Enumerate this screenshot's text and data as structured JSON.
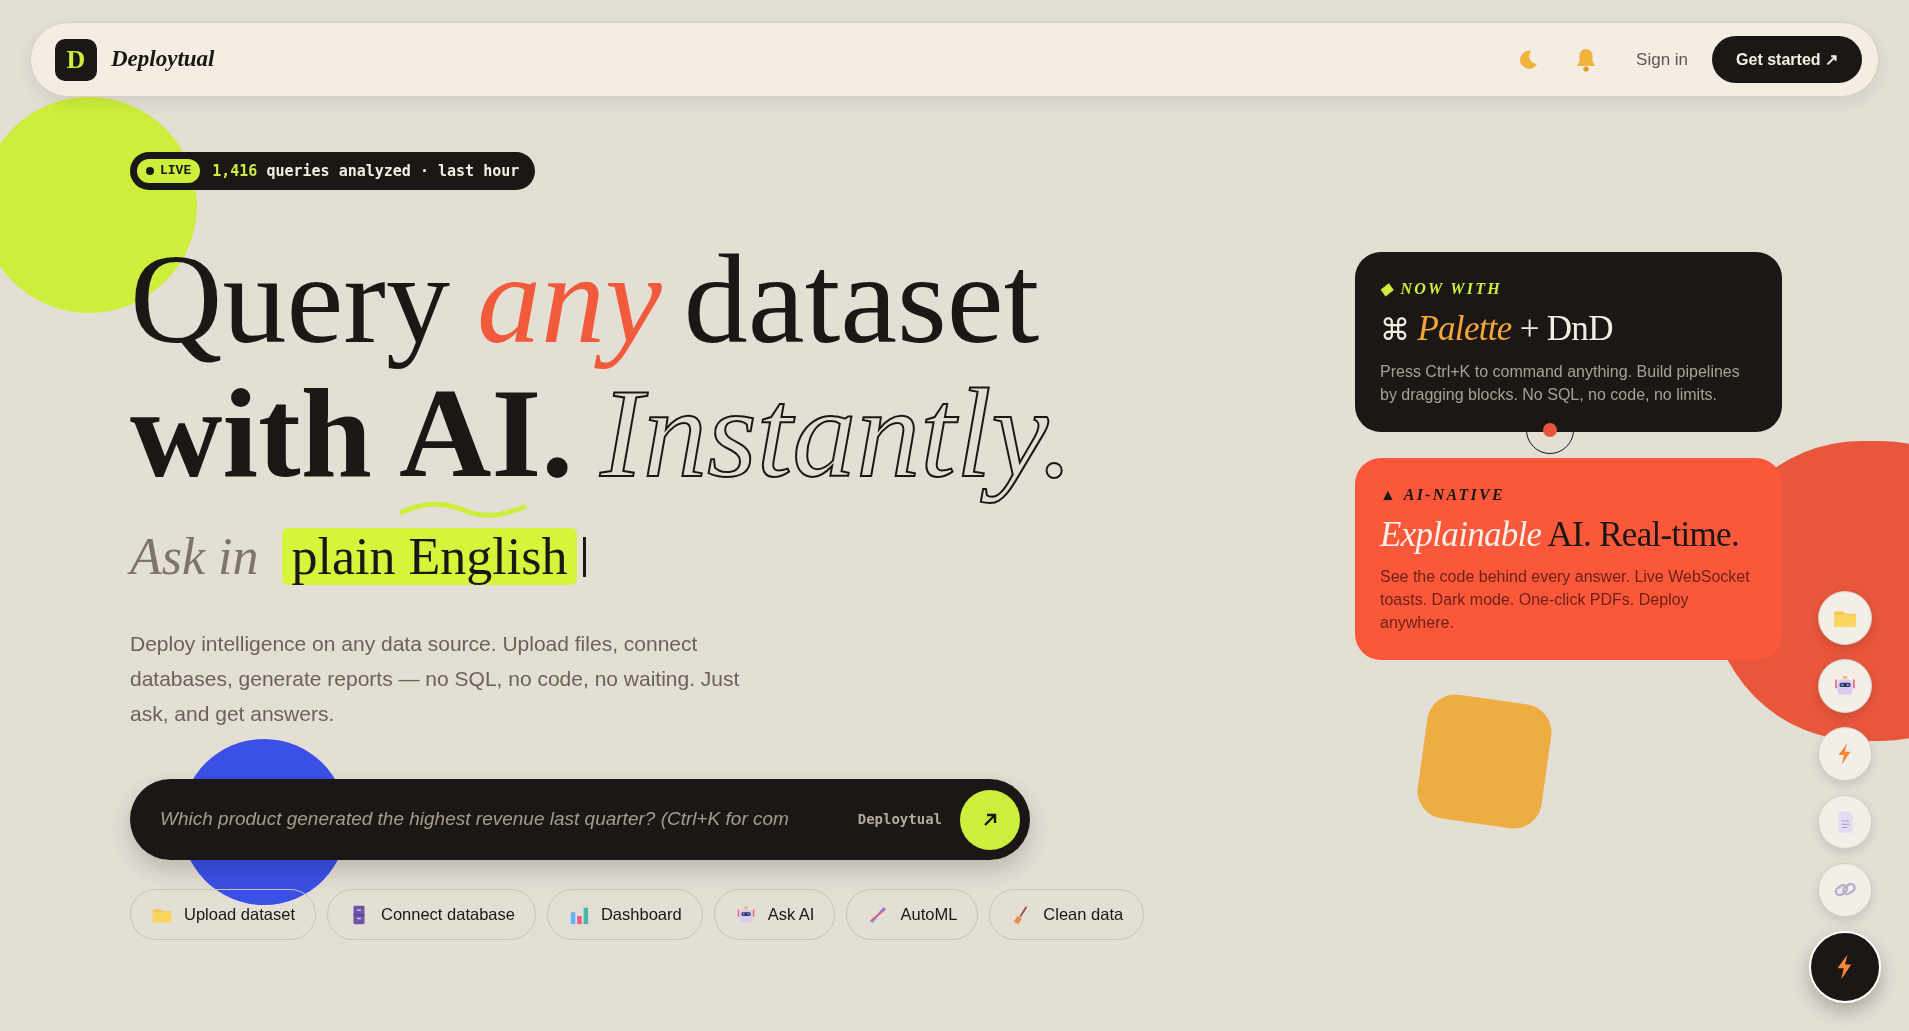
{
  "header": {
    "logo_letter": "D",
    "brand": "Deploytual",
    "sign_in": "Sign in",
    "cta": "Get started ↗"
  },
  "live": {
    "status": "LIVE",
    "count": "1,416",
    "text": "queries analyzed · last hour"
  },
  "headline": {
    "lines": [
      [
        {
          "text": "Query",
          "kind": "plain",
          "squiggle": false
        },
        {
          "text": "any",
          "kind": "accent",
          "squiggle": false
        },
        {
          "text": "dataset",
          "kind": "plain",
          "squiggle": false
        }
      ],
      [
        {
          "text": "with",
          "kind": "bold",
          "squiggle": false
        },
        {
          "text": "AI.",
          "kind": "bold",
          "squiggle": true
        },
        {
          "text": "Instantly.",
          "kind": "outline",
          "squiggle": false
        }
      ]
    ]
  },
  "subheading": {
    "lead": "Ask in",
    "highlight": "plain English"
  },
  "description": "Deploy intelligence on any data source. Upload files, connect databases, generate reports — no SQL, no code, no waiting. Just ask, and get answers.",
  "search": {
    "placeholder": "Which product generated the highest revenue last quarter? (Ctrl+K for com",
    "brand": "Deploytual"
  },
  "chips": [
    {
      "label": "Upload dataset"
    },
    {
      "label": "Connect database"
    },
    {
      "label": "Dashboard"
    },
    {
      "label": "Ask AI"
    },
    {
      "label": "AutoML"
    },
    {
      "label": "Clean data"
    }
  ],
  "cards": [
    {
      "kind": "dark",
      "mark": "◆",
      "kicker": "NOW WITH",
      "title": [
        {
          "text": "⌘",
          "kind": "symbol"
        },
        {
          "text": "Palette",
          "kind": "accent"
        },
        {
          "text": "+ DnD",
          "kind": "plain"
        }
      ],
      "text": "Press Ctrl+K to command anything. Build pipelines by dragging blocks. No SQL, no code, no limits."
    },
    {
      "kind": "coral",
      "mark": "▲",
      "kicker": "AI-NATIVE",
      "title": [
        {
          "text": "Explainable",
          "kind": "accent"
        },
        {
          "text": "AI. Real-time.",
          "kind": "plain"
        }
      ],
      "text": "See the code behind every answer. Live WebSocket toasts. Dark mode. One-click PDFs. Deploy anywhere."
    }
  ]
}
